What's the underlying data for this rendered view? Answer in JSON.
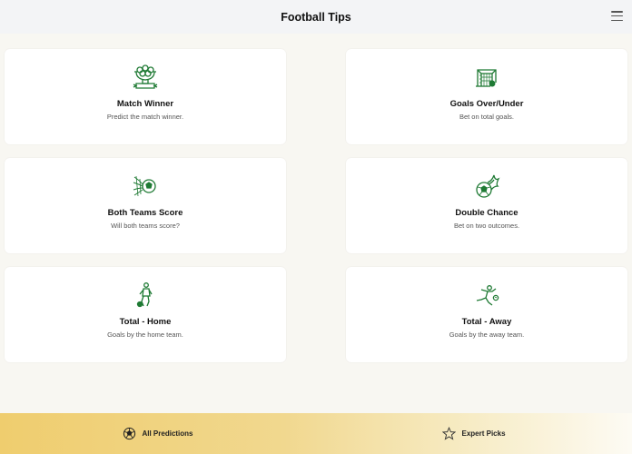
{
  "header": {
    "title": "Football Tips"
  },
  "cards": [
    {
      "title": "Match Winner",
      "description": "Predict the match winner.",
      "icon": "trophy-balls-icon"
    },
    {
      "title": "Goals Over/Under",
      "description": "Bet on total goals.",
      "icon": "goal-net-icon"
    },
    {
      "title": "Both Teams Score",
      "description": "Will both teams score?",
      "icon": "ball-net-icon"
    },
    {
      "title": "Double Chance",
      "description": "Bet on two outcomes.",
      "icon": "flaming-ball-icon"
    },
    {
      "title": "Total - Home",
      "description": "Goals by the home team.",
      "icon": "player-home-icon"
    },
    {
      "title": "Total - Away",
      "description": "Goals by the away team.",
      "icon": "player-away-icon"
    }
  ],
  "bottom_nav": [
    {
      "label": "All Predictions",
      "icon": "soccer-ball-icon"
    },
    {
      "label": "Expert Picks",
      "icon": "star-icon"
    }
  ],
  "colors": {
    "icon_green": "#1f7a34",
    "header_bg": "#f3f4f6",
    "page_bg": "#f8f7f2",
    "nav_gold": "#efcd6e"
  }
}
